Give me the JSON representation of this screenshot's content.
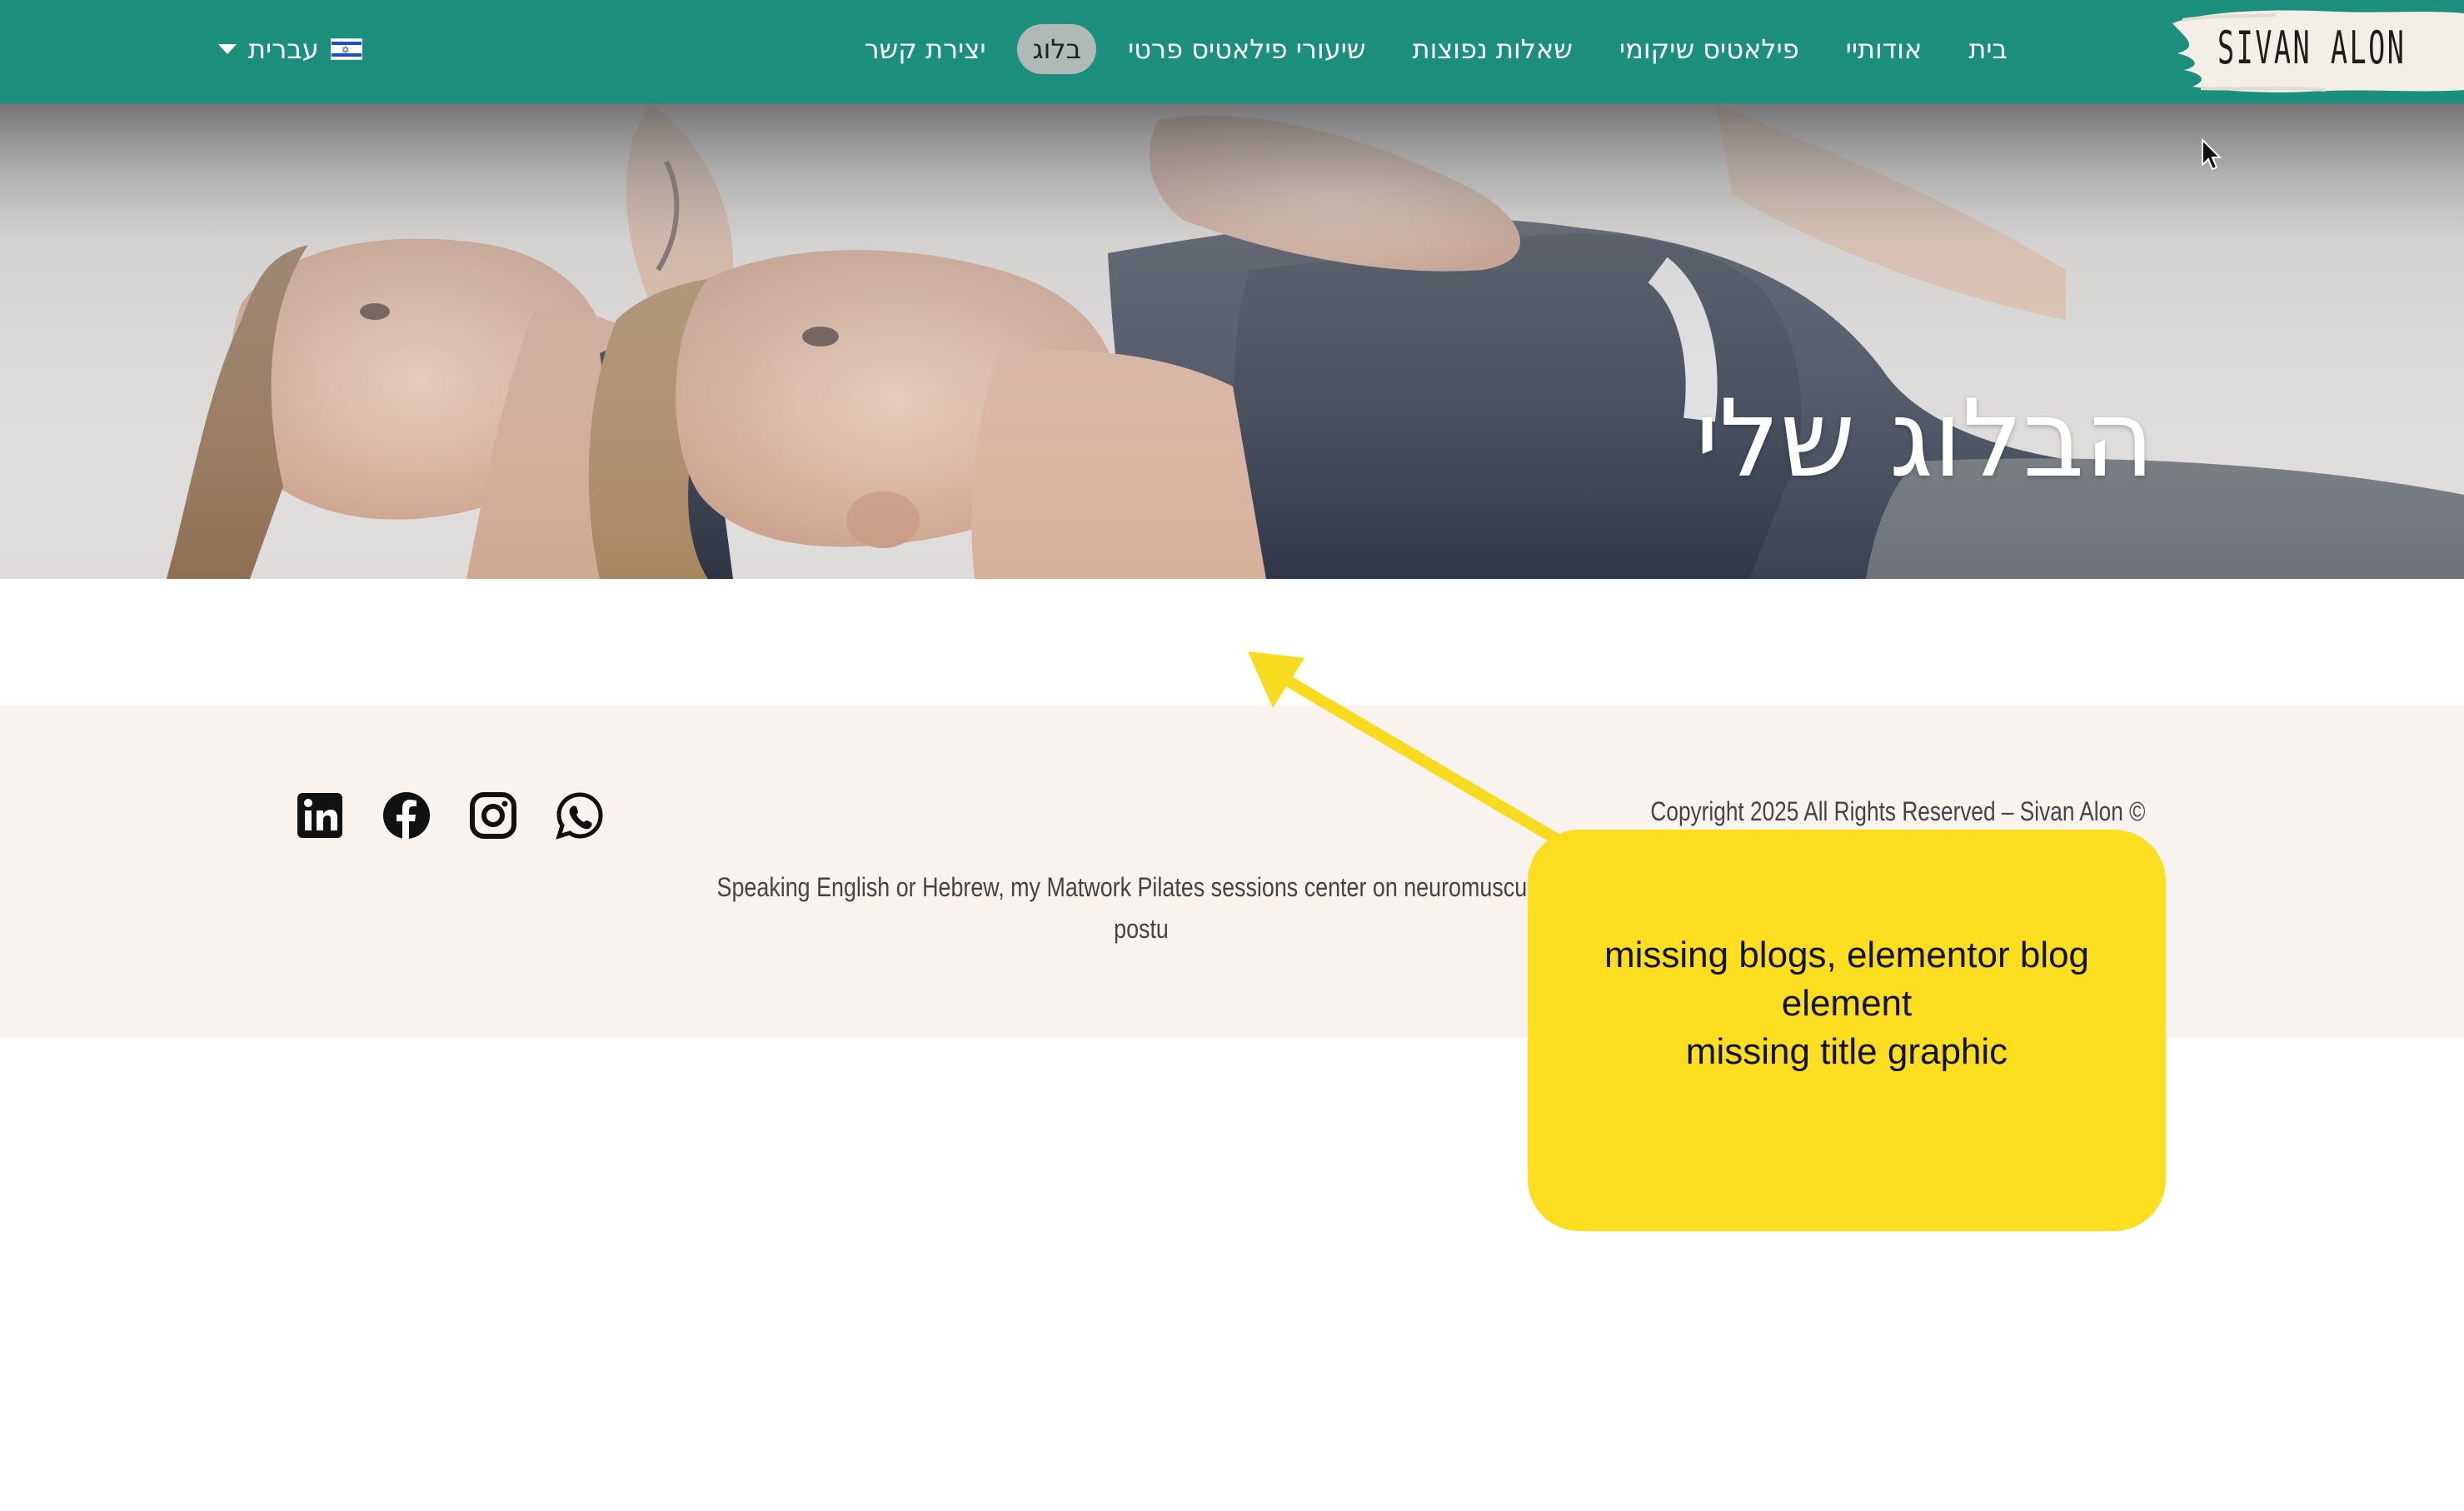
{
  "site": {
    "logo_text": "SIVAN ALON"
  },
  "nav": {
    "items": [
      {
        "label": "בית",
        "active": false
      },
      {
        "label": "אודותיי",
        "active": false
      },
      {
        "label": "פילאטיס שיקומי",
        "active": false
      },
      {
        "label": "שאלות נפוצות",
        "active": false
      },
      {
        "label": "שיעורי פילאטיס פרטי",
        "active": false
      },
      {
        "label": "בלוג",
        "active": true
      },
      {
        "label": "יצירת קשר",
        "active": false
      }
    ],
    "language": {
      "label": "עברית",
      "flag": "israel-flag-icon"
    }
  },
  "hero": {
    "title": "הבלוג שלי"
  },
  "footer": {
    "social": [
      "linkedin-icon",
      "facebook-icon",
      "instagram-icon",
      "whatsapp-icon"
    ],
    "copyright": "Copyright 2025 All Rights Reserved – Sivan Alon ©",
    "description_line1": "Speaking English or Hebrew, my Matwork Pilates sessions center on neuromuscular r",
    "description_line2": "postu"
  },
  "annotation": {
    "lines": [
      "missing blogs, elementor blog",
      "element",
      "missing title graphic"
    ],
    "color": "#fbde1f"
  },
  "colors": {
    "header": "#1b8f7c",
    "footer": "#f8f3ee",
    "active_nav": "#b0b9b6"
  }
}
